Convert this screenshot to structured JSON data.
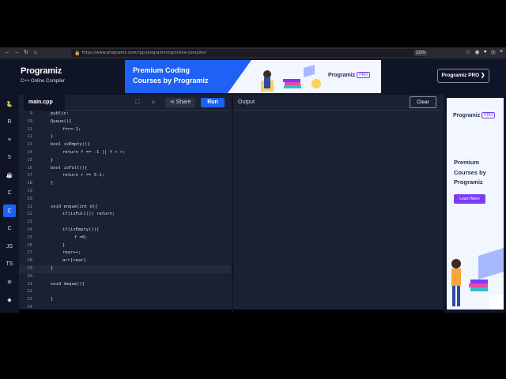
{
  "browser": {
    "url": "https://www.programiz.com/cpp-programming/online-compiler/",
    "zoom": "133%",
    "nav_icons": [
      "back-icon",
      "forward-icon",
      "reload-icon",
      "home-icon"
    ]
  },
  "header": {
    "logo": "Programiz",
    "subtitle": "C++ Online Compiler",
    "banner": {
      "line1": "Premium Coding",
      "line2": "Courses by Programiz",
      "brand": "Programiz",
      "brand_pro": "PRO"
    },
    "pro_button": "Programiz PRO ❯"
  },
  "rail": {
    "items": [
      {
        "name": "python",
        "label": "🐍"
      },
      {
        "name": "r",
        "label": "R"
      },
      {
        "name": "sql",
        "label": "≡"
      },
      {
        "name": "html",
        "label": "5"
      },
      {
        "name": "java",
        "label": "☕"
      },
      {
        "name": "c",
        "label": "C"
      },
      {
        "name": "cpp",
        "label": "C",
        "active": true
      },
      {
        "name": "csharp",
        "label": "C"
      },
      {
        "name": "js",
        "label": "JS"
      },
      {
        "name": "ts",
        "label": "TS"
      },
      {
        "name": "go",
        "label": "≣"
      },
      {
        "name": "swift",
        "label": "◆"
      }
    ]
  },
  "editor": {
    "filename": "main.cpp",
    "share_label": "Share",
    "run_label": "Run",
    "lines": [
      {
        "n": "9",
        "indent": 0,
        "text": "public:"
      },
      {
        "n": "10",
        "indent": 0,
        "text": "Queue(){"
      },
      {
        "n": "11",
        "indent": 1,
        "text": "f=r=-1;"
      },
      {
        "n": "12",
        "indent": 0,
        "text": "}"
      },
      {
        "n": "13",
        "indent": 0,
        "text": "bool isEmpty(){"
      },
      {
        "n": "14",
        "indent": 1,
        "text": "return f == -1 || f > r;"
      },
      {
        "n": "15",
        "indent": 0,
        "text": "}"
      },
      {
        "n": "16",
        "indent": 0,
        "text": "bool isFull(){"
      },
      {
        "n": "17",
        "indent": 1,
        "text": "return r == 5-1;"
      },
      {
        "n": "18",
        "indent": 0,
        "text": "}"
      },
      {
        "n": "19",
        "indent": 0,
        "text": ""
      },
      {
        "n": "20",
        "indent": 0,
        "text": ""
      },
      {
        "n": "21",
        "indent": 0,
        "text": "void enque(int d){"
      },
      {
        "n": "22",
        "indent": 1,
        "text": "if(isFull()) return;"
      },
      {
        "n": "23",
        "indent": 1,
        "text": ""
      },
      {
        "n": "24",
        "indent": 1,
        "text": "if(isEmpty()){"
      },
      {
        "n": "25",
        "indent": 2,
        "text": "f =0;"
      },
      {
        "n": "26",
        "indent": 1,
        "text": "}"
      },
      {
        "n": "27",
        "indent": 1,
        "text": "rear++;"
      },
      {
        "n": "28",
        "indent": 1,
        "text": "arr[rear]"
      },
      {
        "n": "29",
        "indent": 0,
        "text": "}",
        "highlight": true
      },
      {
        "n": "30",
        "indent": 0,
        "text": ""
      },
      {
        "n": "31",
        "indent": 0,
        "text": "void deque(){"
      },
      {
        "n": "32",
        "indent": 0,
        "text": ""
      },
      {
        "n": "33",
        "indent": 0,
        "text": "}"
      },
      {
        "n": "34",
        "indent": 0,
        "text": ""
      }
    ]
  },
  "output": {
    "label": "Output",
    "clear_label": "Clear"
  },
  "right_ad": {
    "brand": "Programiz",
    "brand_pro": "PRO",
    "headline": [
      "Premium",
      "Courses by",
      "Programiz"
    ],
    "button": "Learn More"
  }
}
